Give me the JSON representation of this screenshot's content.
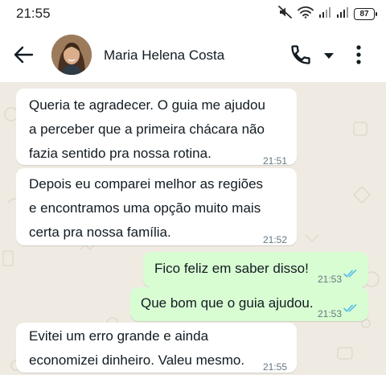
{
  "status_bar": {
    "time": "21:55",
    "battery": "87",
    "icons": [
      "mute-icon",
      "wifi-icon",
      "signal-icon",
      "signal-icon",
      "battery-icon"
    ]
  },
  "header": {
    "back_icon": "arrow-left-icon",
    "contact_name": "Maria Helena Costa",
    "call_icon": "phone-icon",
    "dropdown_icon": "caret-down-icon",
    "menu_icon": "more-vertical-icon"
  },
  "colors": {
    "incoming_bubble": "#ffffff",
    "outgoing_bubble": "#d9fdd3",
    "chat_background": "#efeae2",
    "read_ticks": "#53bdeb",
    "timestamp": "#667781"
  },
  "messages": [
    {
      "direction": "in",
      "text": "Queria te agradecer. O guia me ajudou\na perceber que a primeira chácara não\nfazia sentido pra nossa rotina.",
      "time": "21:51"
    },
    {
      "direction": "in",
      "text": "Depois eu comparei melhor as regiões\ne encontramos uma opção muito mais\ncerta pra nossa família.",
      "time": "21:52"
    },
    {
      "direction": "out",
      "text": "Fico feliz em saber disso!",
      "time": "21:53",
      "status": "read"
    },
    {
      "direction": "out",
      "text": "Que bom que o guia ajudou.",
      "time": "21:53",
      "status": "read"
    },
    {
      "direction": "in",
      "text": "Evitei um erro grande e ainda\neconomizei dinheiro. Valeu mesmo.",
      "time": "21:55"
    }
  ]
}
